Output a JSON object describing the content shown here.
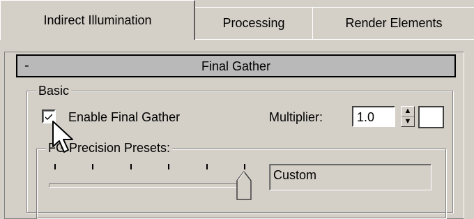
{
  "tabs": [
    {
      "label": "Indirect Illumination"
    },
    {
      "label": "Processing"
    },
    {
      "label": "Render Elements"
    }
  ],
  "rollout": {
    "collapse_symbol": "-",
    "title": "Final Gather"
  },
  "basic_group": {
    "label": "Basic",
    "enable_final_gather": {
      "label": "Enable Final Gather",
      "checked": true
    },
    "multiplier": {
      "label": "Multiplier:",
      "value": "1.0"
    },
    "swatch_color": "#ffffff"
  },
  "precision_presets": {
    "label": "FG Precision Presets:",
    "slider_level": 1.0,
    "tick_count": 6,
    "preset_value": "Custom"
  },
  "icons": {
    "checkmark": "checkmark-icon",
    "cursor": "arrow-cursor-icon",
    "spinner_up": "spinner-up-icon",
    "spinner_down": "spinner-down-icon"
  }
}
